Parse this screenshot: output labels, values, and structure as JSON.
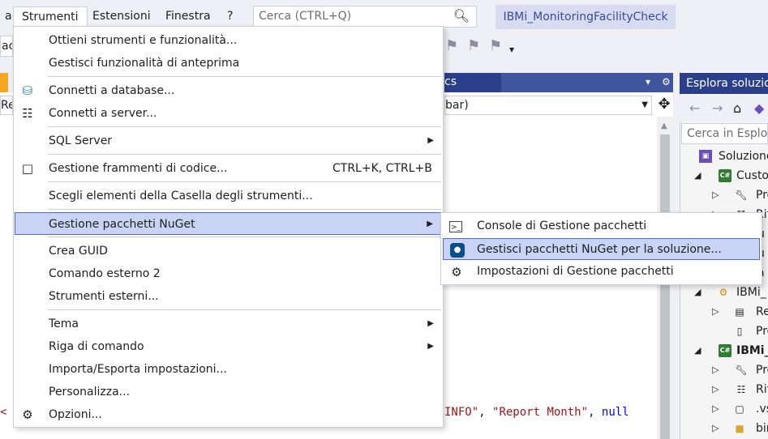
{
  "menubar": {
    "partial_left": "a",
    "items": [
      "Strumenti",
      "Estensioni",
      "Finestra",
      "?"
    ],
    "search_placeholder": "Cerca (CTRL+Q)",
    "solution_name": "IBMi_MonitoringFacilityCheck"
  },
  "toolbar": {
    "partial_left": "ac"
  },
  "editor": {
    "tab_partial": "cs",
    "nav_left_partial": "Re",
    "nav_right_partial": "bar)",
    "code_left_partial": "< r",
    "code_line": {
      "s1": "INFO\"",
      "p1": ", ",
      "s2": "\"Report Month\"",
      "p2": ", ",
      "kw": "null"
    }
  },
  "tools_menu": {
    "items": [
      {
        "label": "Ottieni strumenti e funzionalità...",
        "icon": ""
      },
      {
        "label": "Gestisci funzionalità di anteprima",
        "icon": ""
      },
      {
        "label": "Connetti a database...",
        "icon": "database-plug-icon"
      },
      {
        "label": "Connetti a server...",
        "icon": "server-icon"
      },
      {
        "label": "SQL Server",
        "icon": "",
        "submenu": true
      },
      {
        "label": "Gestione frammenti di codice...",
        "icon": "snippet-icon",
        "shortcut": "CTRL+K, CTRL+B"
      },
      {
        "label": "Scegli elementi della Casella degli strumenti...",
        "icon": ""
      },
      {
        "label": "Gestione pacchetti NuGet",
        "icon": "",
        "submenu": true,
        "highlighted": true
      },
      {
        "label": "Crea GUID",
        "icon": ""
      },
      {
        "label": "Comando esterno 2",
        "icon": ""
      },
      {
        "label": "Strumenti esterni...",
        "icon": ""
      },
      {
        "label": "Tema",
        "icon": "",
        "submenu": true
      },
      {
        "label": "Riga di comando",
        "icon": "",
        "submenu": true
      },
      {
        "label": "Importa/Esporta impostazioni...",
        "icon": ""
      },
      {
        "label": "Personalizza...",
        "icon": ""
      },
      {
        "label": "Opzioni...",
        "icon": "gear-icon"
      }
    ]
  },
  "nuget_menu": {
    "items": [
      {
        "label": "Console di Gestione pacchetti",
        "icon": "console-icon"
      },
      {
        "label": "Gestisci pacchetti NuGet per la soluzione...",
        "icon": "nuget-icon",
        "highlighted": true
      },
      {
        "label": "Impostazioni di Gestione pacchetti",
        "icon": "gear-icon"
      }
    ]
  },
  "solution_explorer": {
    "title": "Esplora soluzioni",
    "search_placeholder": "Cerca in Esplora",
    "rows": [
      {
        "label": "Soluzione"
      },
      {
        "label": "Custo"
      },
      {
        "label": "Pro"
      },
      {
        "label": "Rif"
      },
      {
        "label": "u"
      },
      {
        "label": "u"
      },
      {
        "label": "a"
      },
      {
        "label": "IBMi_"
      },
      {
        "label": "Re"
      },
      {
        "label": "Pro"
      },
      {
        "label": "IBMi_"
      },
      {
        "label": "Pro"
      },
      {
        "label": "Rif"
      },
      {
        "label": ".vs"
      },
      {
        "label": "bir"
      }
    ]
  }
}
